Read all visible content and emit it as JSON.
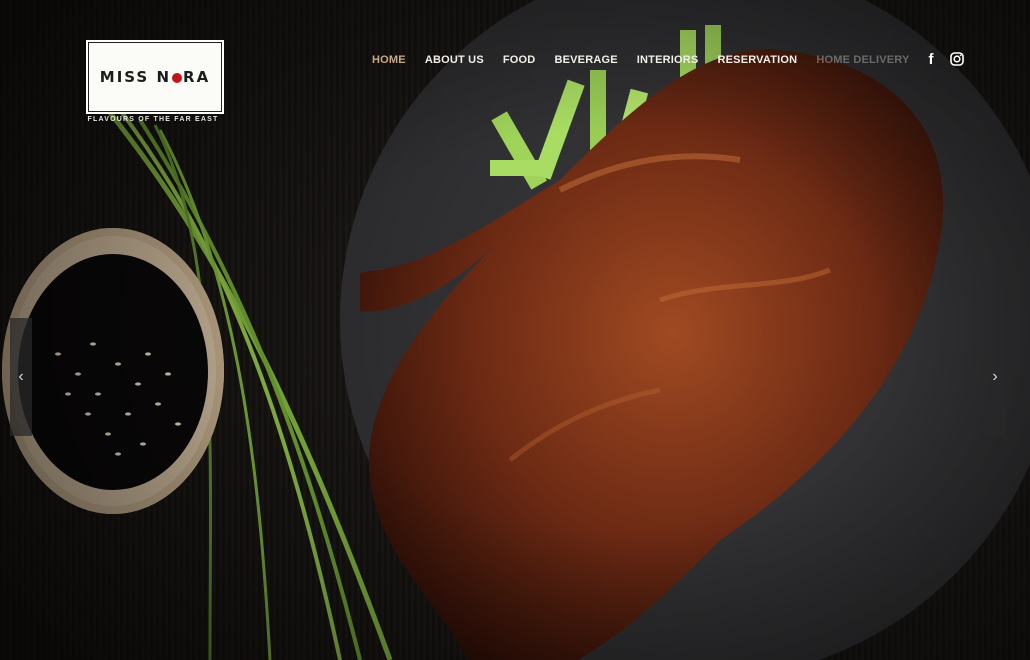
{
  "brand": {
    "logo_text_part1": "MISS N",
    "logo_text_part2": "RA",
    "tagline": "FLAVOURS OF THE FAR EAST"
  },
  "nav": {
    "items": [
      {
        "label": "HOME",
        "active": true
      },
      {
        "label": "ABOUT US"
      },
      {
        "label": "FOOD"
      },
      {
        "label": "BEVERAGE"
      },
      {
        "label": "INTERIORS"
      },
      {
        "label": "RESERVATION"
      },
      {
        "label": "HOME DELIVERY"
      }
    ]
  },
  "social": {
    "facebook": "f",
    "instagram_icon": "instagram-icon"
  },
  "slider": {
    "prev": "‹",
    "next": "›"
  },
  "colors": {
    "active_nav": "#c9a98a",
    "brand_red": "#c4141b"
  }
}
